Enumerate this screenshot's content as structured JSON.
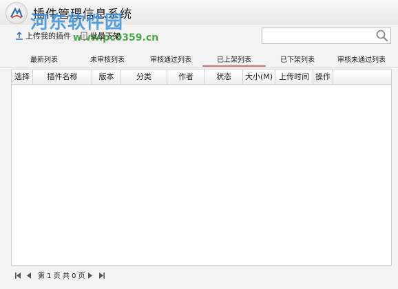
{
  "window": {
    "title": "插件管理信息系统"
  },
  "watermark": {
    "name": "河东软件园",
    "url": "www.pc0359.cn"
  },
  "toolbar": {
    "upload_label": "上传我的插件",
    "batch_remove_label": "批量下架"
  },
  "search": {
    "value": "",
    "placeholder": ""
  },
  "tabs": [
    {
      "label": "最新列表"
    },
    {
      "label": "未审核列表"
    },
    {
      "label": "审核通过列表"
    },
    {
      "label": "已上架列表",
      "active": true
    },
    {
      "label": "已下架列表"
    },
    {
      "label": "审核未通过列表"
    }
  ],
  "table": {
    "columns": [
      "选择",
      "插件名称",
      "版本",
      "分类",
      "作者",
      "状态",
      "大小(M)",
      "上传时间",
      "操作"
    ],
    "rows": []
  },
  "pager": {
    "info": "第 1 页 共 0 页"
  },
  "colors": {
    "active_tab_underline": "#d96b6b",
    "watermark_blue": "#3a8fd8",
    "watermark_green": "#2e9a2e"
  },
  "icons": [
    "app-logo",
    "upload-icon",
    "batch-remove-icon",
    "search-icon",
    "first-page-icon",
    "prev-page-icon",
    "next-page-icon",
    "last-page-icon"
  ]
}
